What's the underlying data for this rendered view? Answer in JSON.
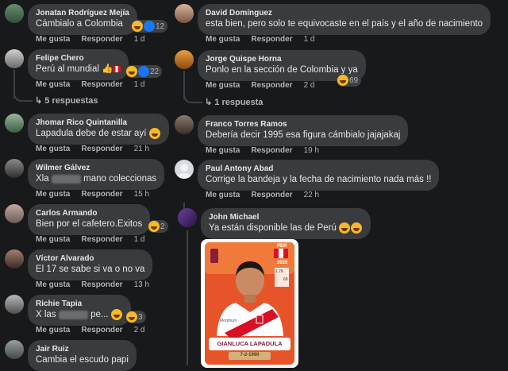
{
  "colors": {
    "bg": "#18191a",
    "bubble": "#3a3b3c",
    "meta": "#b0b3b8",
    "haha": "#f7b928",
    "like": "#1877f2"
  },
  "actions": {
    "like": "Me gusta",
    "reply": "Responder"
  },
  "left": [
    {
      "name": "Jonatan Rodríguez Mejía",
      "text": "Cámbialo a Colombia",
      "time": "1 d",
      "reaction_count": "12"
    },
    {
      "name": "Felipe Chero",
      "text": "Perú al mundial",
      "time": "1 d",
      "reaction_count": "22",
      "replies": "5 respuestas"
    },
    {
      "name": "Jhomar Rico Quintanilla",
      "text": "Lapadula debe de estar ayí",
      "time": "21 h"
    },
    {
      "name": "Wilmer Gálvez",
      "text_before": "Xla",
      "blurred": "huevas",
      "text_after": "mano coleccionas",
      "time": "15 h"
    },
    {
      "name": "Carlos Armando",
      "text": "Bien por el cafetero.Exitos",
      "time": "1 d",
      "reaction_count": "2"
    },
    {
      "name": "Víctor Alvarado",
      "text": "El 17 se sabe si va o no va",
      "time": "13 h"
    },
    {
      "name": "Richie Tapia",
      "text_before": "X las",
      "blurred": "huevas",
      "text_after": "pe...",
      "time": "2 d",
      "reaction_count": "3"
    },
    {
      "name": "Jair Ruiz",
      "text": "Cambia el escudo papi"
    }
  ],
  "right": [
    {
      "name": "David Domínguez",
      "text": "esta bien, pero solo te equivocaste en el país y el año de nacimiento",
      "time": "1 d"
    },
    {
      "name": "Jorge Quispe Horna",
      "text": "Ponlo en la sección de Colombia y ya",
      "time": "2 d",
      "reaction_count": "69",
      "replies": "1 respuesta"
    },
    {
      "name": "Franco Torres Ramos",
      "text": "Debería decir 1995 esa figura cámbialo jajajakaj",
      "time": "19 h"
    },
    {
      "name": "Paul Antony Abad",
      "text": "Corrige la bandeja y la fecha de nacimiento nada más !!",
      "time": "22 h"
    },
    {
      "name": "John Michael",
      "text": "Ya están disponible las de Perú"
    }
  ],
  "sticker": {
    "country": "PER",
    "year": "2020",
    "player": "GIANLUCA LAPADULA",
    "birth": "7-2-1990",
    "stats_a": "1,78",
    "stats_b": "69",
    "sponsor": "Morphum"
  }
}
